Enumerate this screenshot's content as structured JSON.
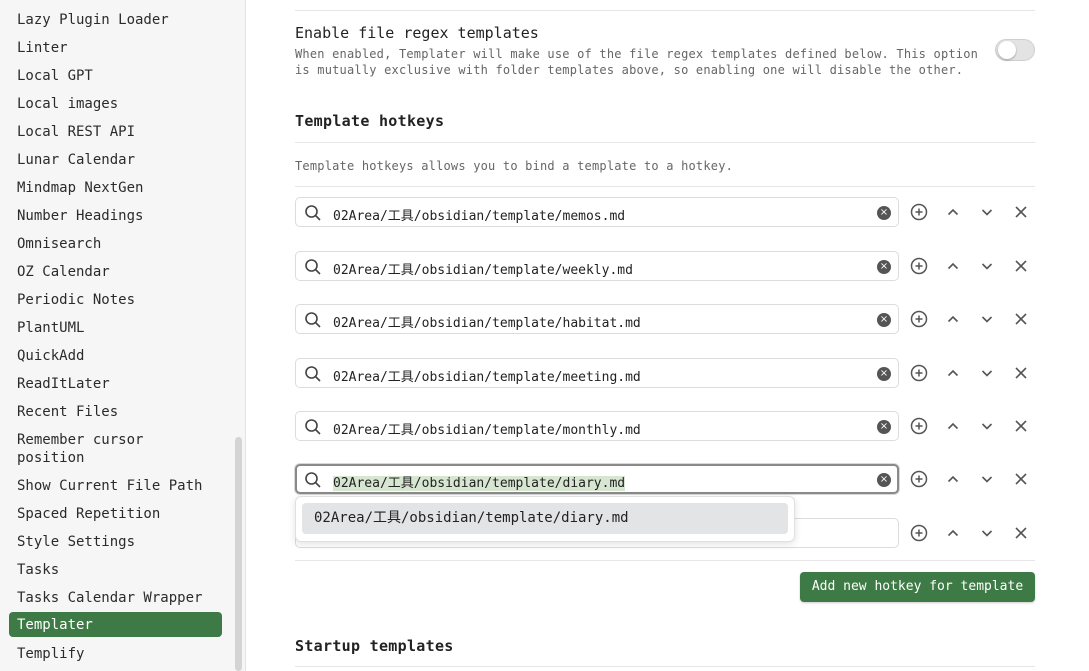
{
  "sidebar": {
    "items": [
      {
        "label": "Lazy Plugin Loader"
      },
      {
        "label": "Linter"
      },
      {
        "label": "Local GPT"
      },
      {
        "label": "Local images"
      },
      {
        "label": "Local REST API"
      },
      {
        "label": "Lunar Calendar"
      },
      {
        "label": "Mindmap NextGen"
      },
      {
        "label": "Number Headings"
      },
      {
        "label": "Omnisearch"
      },
      {
        "label": "OZ Calendar"
      },
      {
        "label": "Periodic Notes"
      },
      {
        "label": "PlantUML"
      },
      {
        "label": "QuickAdd"
      },
      {
        "label": "ReadItLater"
      },
      {
        "label": "Recent Files"
      },
      {
        "label": "Remember cursor position"
      },
      {
        "label": "Show Current File Path"
      },
      {
        "label": "Spaced Repetition"
      },
      {
        "label": "Style Settings"
      },
      {
        "label": "Tasks"
      },
      {
        "label": "Tasks Calendar Wrapper"
      },
      {
        "label": "Templater",
        "active": true
      },
      {
        "label": "Templify"
      }
    ]
  },
  "settings": {
    "regex": {
      "name": "Enable file regex templates",
      "desc": "When enabled, Templater will make use of the file regex templates defined below. This option is mutually exclusive with folder templates above, so enabling one will disable the other.",
      "enabled": false
    },
    "hotkeys": {
      "heading": "Template hotkeys",
      "desc": "Template hotkeys allows you to bind a template to a hotkey.",
      "rows": [
        {
          "value": "02Area/工具/obsidian/template/memos.md"
        },
        {
          "value": "02Area/工具/obsidian/template/weekly.md"
        },
        {
          "value": "02Area/工具/obsidian/template/habitat.md"
        },
        {
          "value": "02Area/工具/obsidian/template/meeting.md"
        },
        {
          "value": "02Area/工具/obsidian/template/monthly.md"
        },
        {
          "value": "02Area/工具/obsidian/template/diary.md"
        },
        {
          "value": ""
        }
      ],
      "suggestion": "02Area/工具/obsidian/template/diary.md",
      "add_button": "Add new hotkey for template"
    },
    "startup": {
      "heading": "Startup templates"
    }
  },
  "icons": {
    "search": "search-icon",
    "clear": "clear-icon",
    "add": "plus-circle-icon",
    "up": "chevron-up-icon",
    "down": "chevron-down-icon",
    "remove": "close-icon"
  },
  "colors": {
    "accent": "#3e7a45",
    "selection": "#d7e6d1"
  }
}
